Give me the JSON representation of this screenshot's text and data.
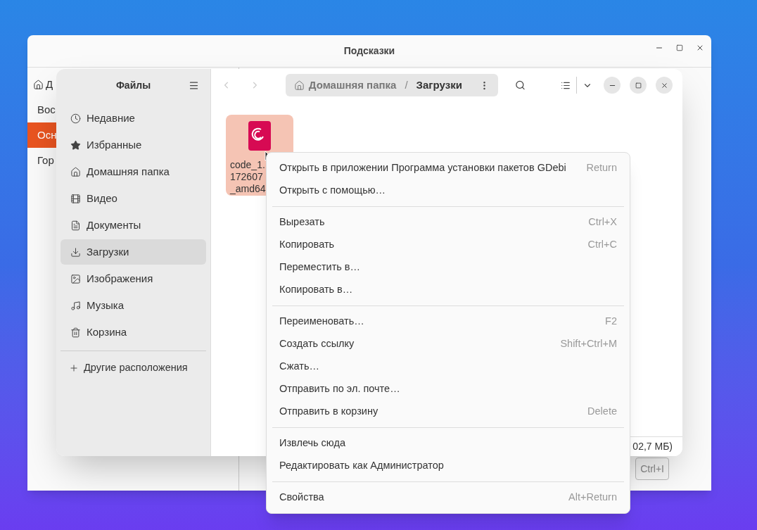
{
  "back_window": {
    "title": "Подсказки",
    "sidebar_items": [
      {
        "label": "Д",
        "selected": false
      },
      {
        "label": "Вос",
        "selected": false
      },
      {
        "label": "Осн",
        "selected": true
      },
      {
        "label": "Гор",
        "selected": false
      }
    ],
    "shortcut_key": "Ctrl+I"
  },
  "files_window": {
    "sidebar": {
      "title": "Файлы",
      "items": [
        {
          "label": "Недавние",
          "selected": false
        },
        {
          "label": "Избранные",
          "selected": false
        },
        {
          "label": "Домашняя папка",
          "selected": false
        },
        {
          "label": "Видео",
          "selected": false
        },
        {
          "label": "Документы",
          "selected": false
        },
        {
          "label": "Загрузки",
          "selected": true
        },
        {
          "label": "Изображения",
          "selected": false
        },
        {
          "label": "Музыка",
          "selected": false
        },
        {
          "label": "Корзина",
          "selected": false
        }
      ],
      "other_locations": "Другие расположения"
    },
    "path": [
      {
        "label": "Домашняя папка",
        "kind": "home"
      },
      {
        "label": "Загрузки",
        "kind": "current"
      }
    ],
    "path_separator": "/",
    "file": {
      "name_lines": [
        "code_1.",
        "172607",
        "_amd64"
      ],
      "selected": true
    },
    "status": "02,7 МБ)"
  },
  "context_menu": {
    "sections": [
      [
        {
          "label": "Открыть в приложении Программа установки пакетов GDebi",
          "shortcut": "Return"
        },
        {
          "label": "Открыть с помощью…"
        }
      ],
      [
        {
          "label": "Вырезать",
          "shortcut": "Ctrl+X"
        },
        {
          "label": "Копировать",
          "shortcut": "Ctrl+C"
        },
        {
          "label": "Переместить в…"
        },
        {
          "label": "Копировать в…"
        }
      ],
      [
        {
          "label": "Переименовать…",
          "shortcut": "F2"
        },
        {
          "label": "Создать ссылку",
          "shortcut": "Shift+Ctrl+M"
        },
        {
          "label": "Сжать…"
        },
        {
          "label": "Отправить по эл. почте…"
        },
        {
          "label": "Отправить в корзину",
          "shortcut": "Delete"
        }
      ],
      [
        {
          "label": "Извлечь сюда"
        },
        {
          "label": "Редактировать как Администратор"
        }
      ],
      [
        {
          "label": "Свойства",
          "shortcut": "Alt+Return"
        }
      ]
    ]
  }
}
